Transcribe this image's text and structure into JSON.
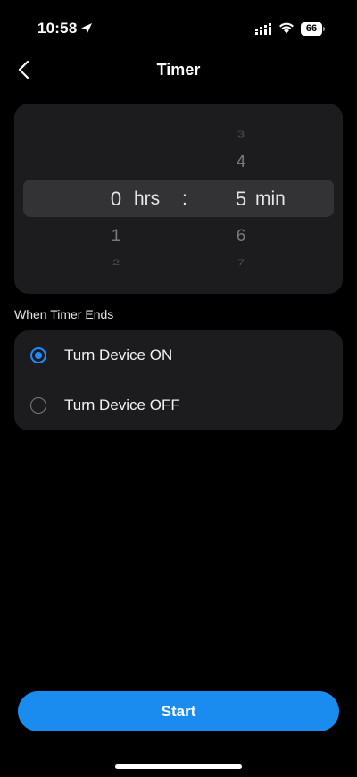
{
  "status_bar": {
    "time": "10:58",
    "battery": "66",
    "icons": [
      "location-arrow-icon",
      "cellular-signal-icon",
      "wifi-icon",
      "battery-icon"
    ]
  },
  "header": {
    "title": "Timer",
    "back_icon": "chevron-left-icon"
  },
  "picker": {
    "hours": {
      "above_far": "",
      "above_near": "",
      "selected": "0",
      "below_near": "1",
      "below_far": "2"
    },
    "hours_unit": "hrs",
    "separator": ":",
    "minutes": {
      "above_far": "3",
      "above_near": "4",
      "selected": "5",
      "below_near": "6",
      "below_far": "7"
    },
    "minutes_unit": "min"
  },
  "when_timer_ends": {
    "label": "When Timer Ends",
    "options": [
      {
        "label": "Turn Device ON",
        "selected": true
      },
      {
        "label": "Turn Device OFF",
        "selected": false
      }
    ]
  },
  "start_button": {
    "label": "Start"
  },
  "colors": {
    "accent": "#1a8cf0",
    "background": "#000000",
    "card": "#1c1c1e"
  }
}
